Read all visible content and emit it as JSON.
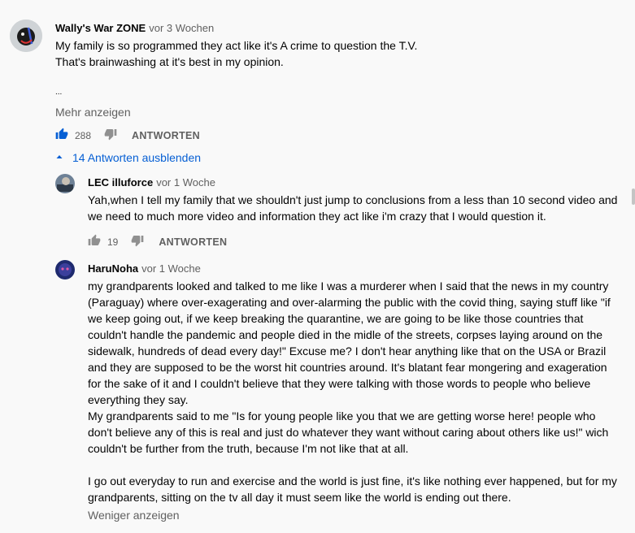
{
  "comment": {
    "author": "Wally's War ZONE",
    "time": "vor 3 Wochen",
    "text": "My family is so programmed they act like it's A crime to question the T.V.\nThat's brainwashing at it's best in my opinion.",
    "ellipsis": "...",
    "more_label": "Mehr anzeigen",
    "likes": "288",
    "reply_label": "ANTWORTEN",
    "toggle_label": "14 Antworten ausblenden"
  },
  "replies": [
    {
      "author": "LEC illuforce",
      "time": "vor 1 Woche",
      "text": "Yah,when I tell my family that we shouldn't just jump to conclusions from a less than 10 second video and we need to much more video and information they act like i'm crazy that I would question it.",
      "likes": "19",
      "reply_label": "ANTWORTEN"
    },
    {
      "author": "HaruNoha",
      "time": "vor 1 Woche",
      "text": "my grandparents looked and talked to me like I was a murderer when I said that the news in my country (Paraguay) where over-exagerating and over-alarming the public with the covid thing, saying stuff like \"if we keep going out, if we keep breaking the quarantine, we are going to be like those countries that couldn't handle the pandemic and people died in the midle of the streets, corpses laying around on the sidewalk, hundreds of dead every day!\" Excuse me? I don't hear anything like that on the USA or Brazil and they are supposed to be the worst hit countries around. It's blatant fear mongering and exageration for the sake of it and I couldn't believe that they were talking with those words to people who believe everything they say.\nMy grandparents said to me \"Is for young people like you that we are getting worse here! people who don't believe any of this is real and just do whatever they want without caring about others like us!\" wich couldn't be further from the truth, because I'm not like that at all.\n\nI go out everyday to run and exercise and the world is just fine, it's like nothing ever happened, but for my grandparents, sitting on the tv all day it must seem like the world is ending out there.",
      "less_label": "Weniger anzeigen"
    }
  ],
  "colors": {
    "link_blue": "#065fd4",
    "text": "#030303",
    "secondary": "#606060",
    "background": "#f9f9f9"
  }
}
